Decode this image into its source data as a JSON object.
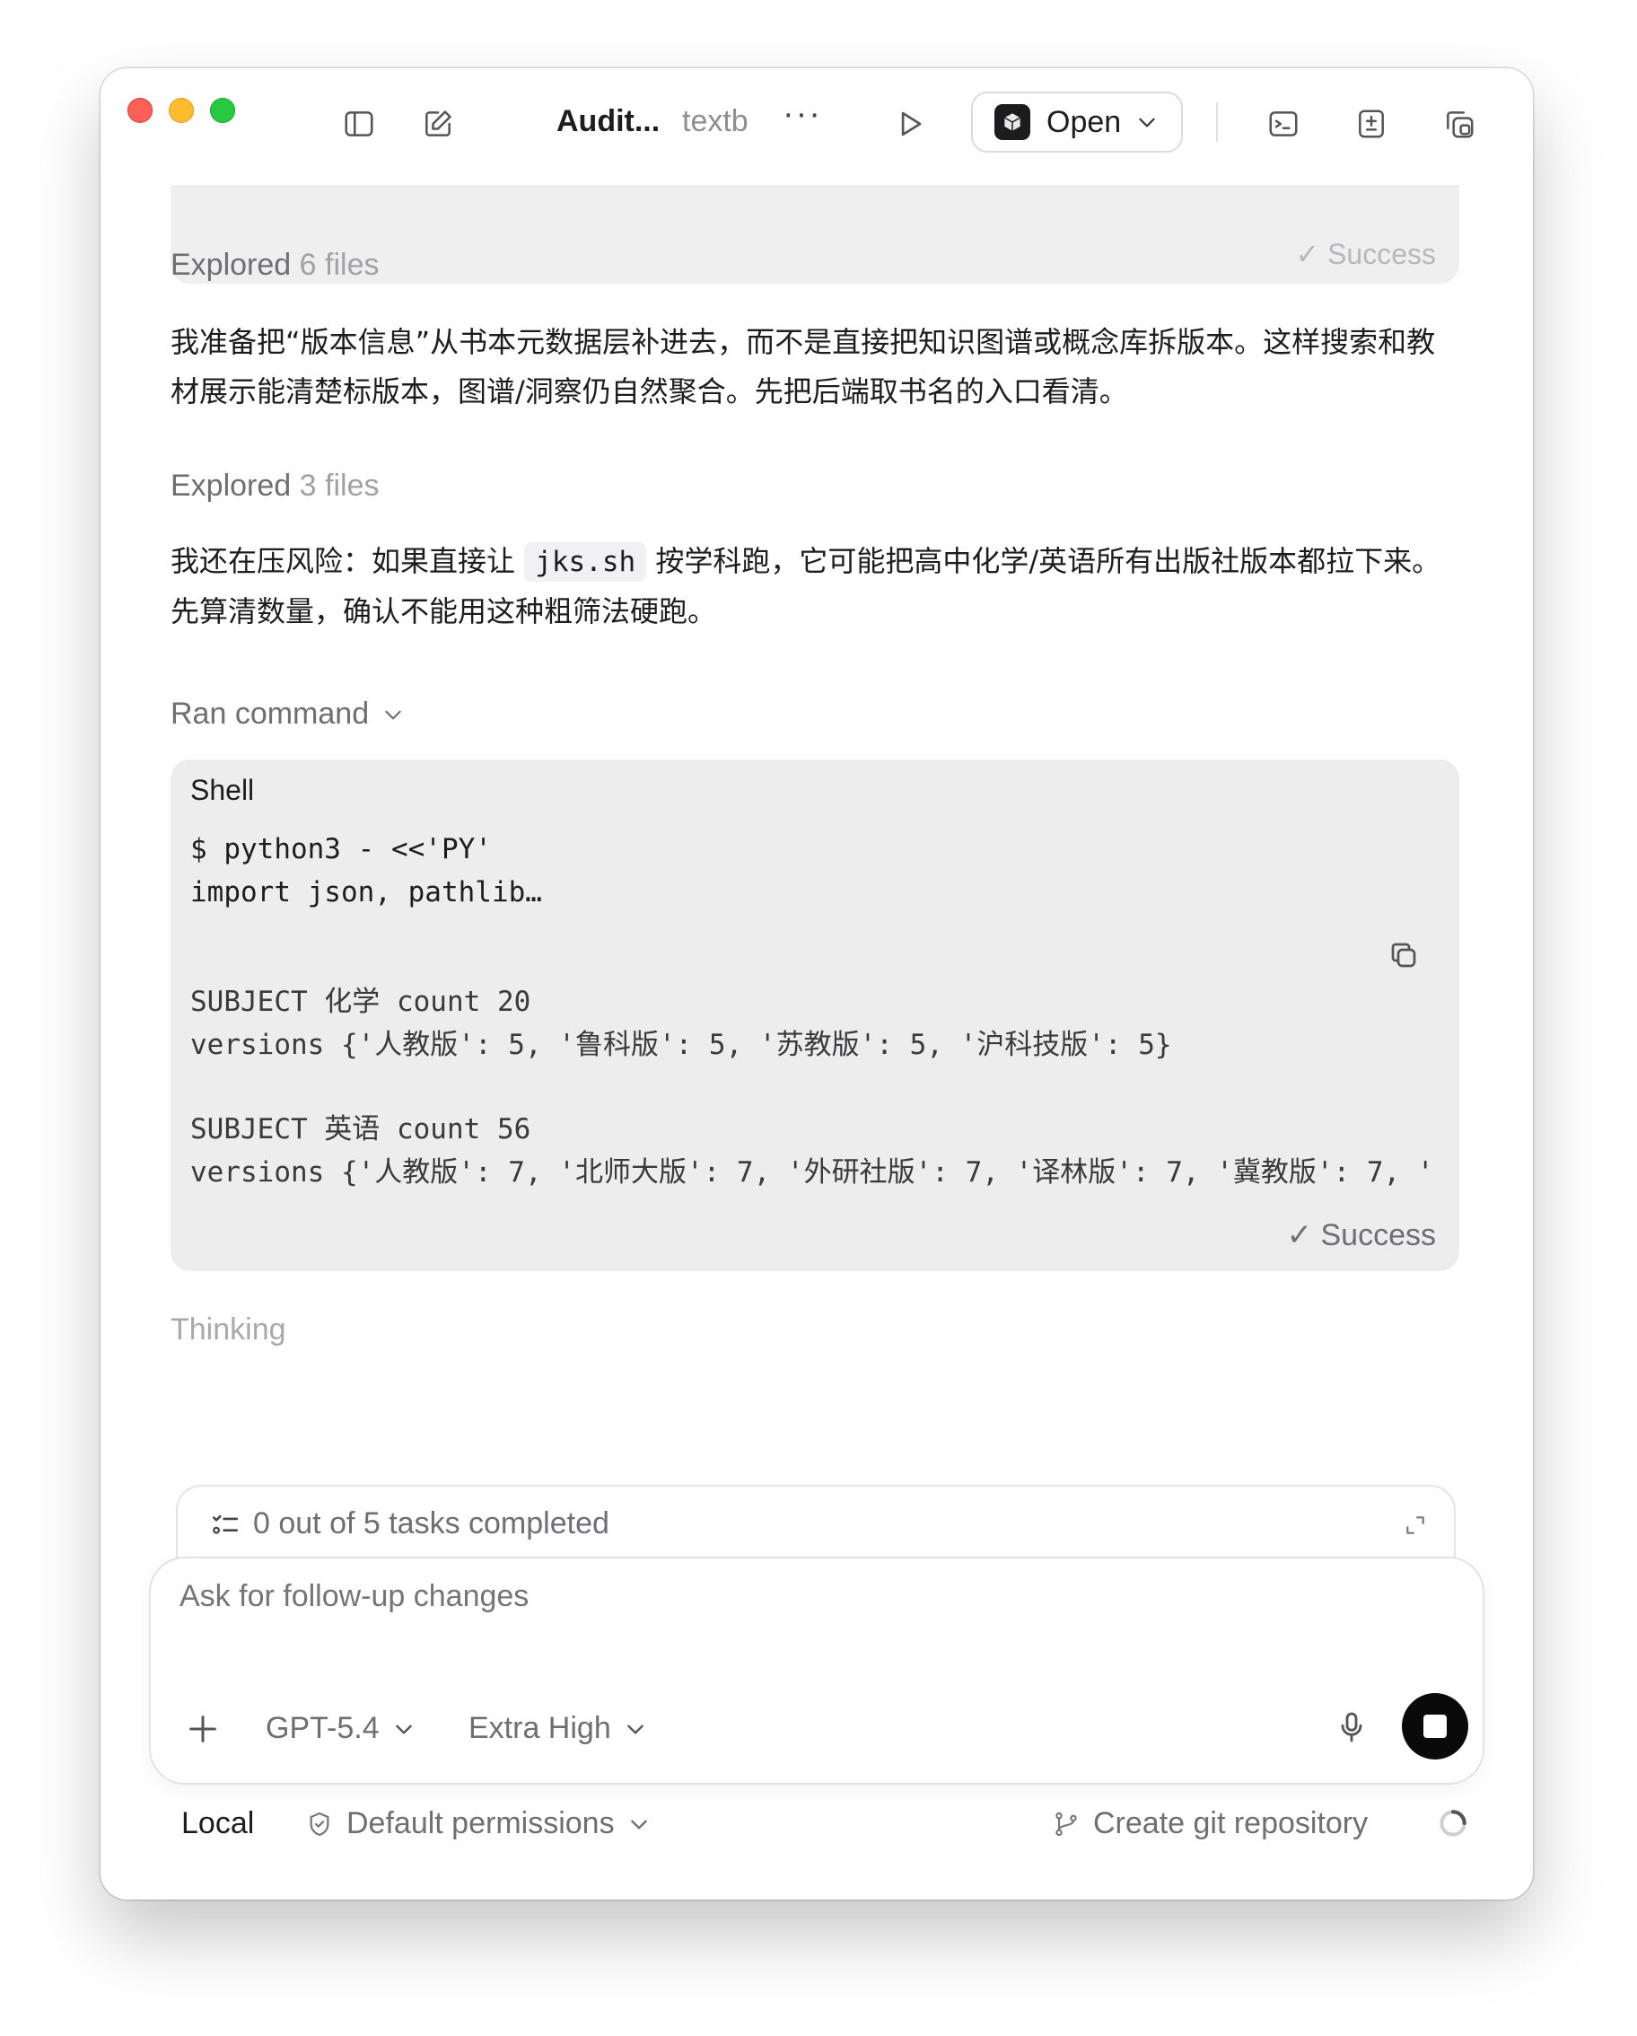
{
  "titlebar": {
    "title": "Audit...",
    "subtitle": "textb",
    "more_label": "···",
    "open_button": "Open",
    "icons": [
      "sidebar-toggle-icon",
      "compose-icon",
      "play-icon",
      "terminal-icon",
      "diff-icon",
      "window-copy-icon"
    ]
  },
  "conversation": {
    "prev_success": "✓ Success",
    "explored_1": {
      "label": "Explored",
      "count": "6 files"
    },
    "para_1": "我准备把“版本信息”从书本元数据层补进去，而不是直接把知识图谱或概念库拆版本。这样搜索和教材展示能清楚标版本，图谱/洞察仍自然聚合。先把后端取书名的入口看清。",
    "explored_2": {
      "label": "Explored",
      "count": "3 files"
    },
    "para_2_before": "我还在压风险：如果直接让 ",
    "para_2_code": "jks.sh",
    "para_2_after": " 按学科跑，它可能把高中化学/英语所有出版社版本都拉下来。先算清数量，确认不能用这种粗筛法硬跑。",
    "ran_command": "Ran command",
    "shell": {
      "title": "Shell",
      "command_line_1": "$ python3 - <<'PY'",
      "command_line_2": "import json, pathlib…",
      "output_line_1": "SUBJECT 化学 count 20",
      "output_line_2": "versions {'人教版': 5, '鲁科版': 5, '苏教版': 5, '沪科技版': 5}",
      "output_line_3": "SUBJECT 英语 count 56",
      "output_line_4": "versions {'人教版': 7, '北师大版': 7, '外研社版': 7, '译林版': 7, '冀教版': 7, '",
      "status": "✓ Success"
    },
    "thinking": "Thinking"
  },
  "tasks": {
    "summary": "0 out of 5 tasks completed"
  },
  "composer": {
    "placeholder": "Ask for follow-up changes",
    "model": "GPT-5.4",
    "effort": "Extra High"
  },
  "footer": {
    "environment": "Local",
    "permissions": "Default permissions",
    "git_action": "Create git repository"
  }
}
